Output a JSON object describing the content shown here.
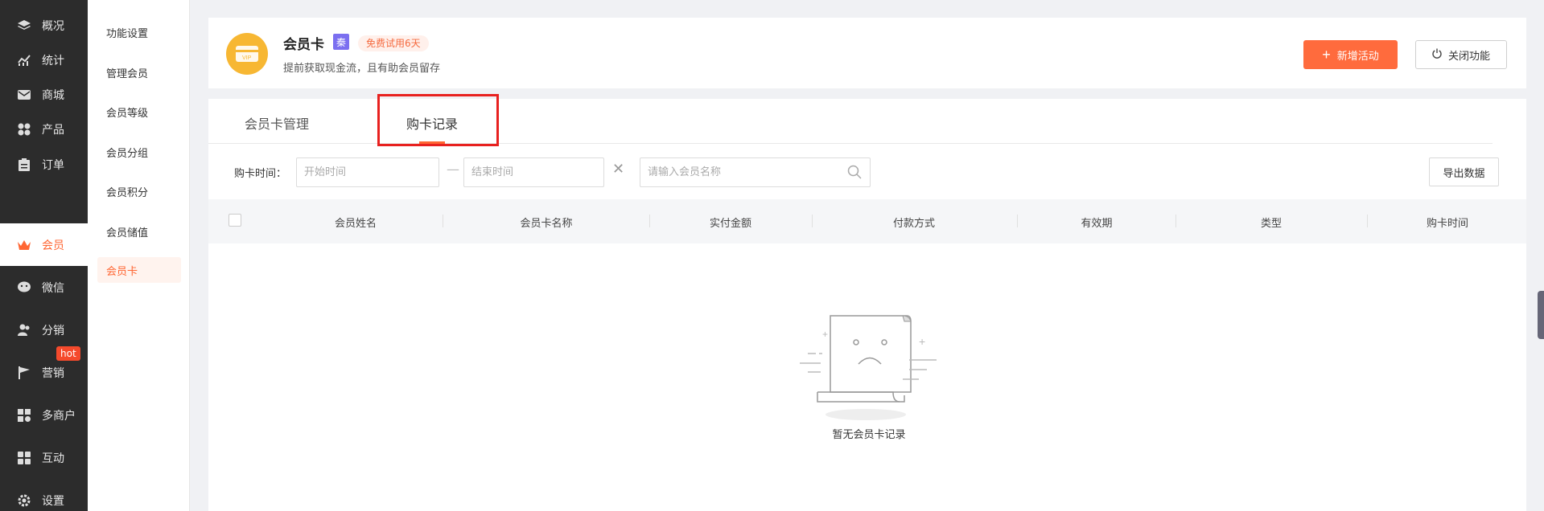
{
  "nav": {
    "items": [
      {
        "label": "概况",
        "icon": "layers-icon"
      },
      {
        "label": "统计",
        "icon": "chart-icon"
      },
      {
        "label": "商城",
        "icon": "mail-icon"
      },
      {
        "label": "产品",
        "icon": "grid-icon"
      },
      {
        "label": "订单",
        "icon": "clipboard-icon"
      },
      {
        "label": "会员",
        "icon": "crown-icon"
      },
      {
        "label": "微信",
        "icon": "wechat-icon"
      },
      {
        "label": "分销",
        "icon": "users-icon"
      },
      {
        "label": "营销",
        "icon": "flag-icon"
      },
      {
        "label": "多商户",
        "icon": "store-icon"
      },
      {
        "label": "互动",
        "icon": "apps-icon"
      },
      {
        "label": "设置",
        "icon": "gear-icon"
      }
    ],
    "active": "会员",
    "hot_badge": "hot"
  },
  "subnav": {
    "items": [
      "功能设置",
      "管理会员",
      "会员等级",
      "会员分组",
      "会员积分",
      "会员储值",
      "会员卡"
    ],
    "active": "会员卡"
  },
  "header": {
    "title": "会员卡",
    "badge": "秦",
    "trial": "免费试用6天",
    "subtitle": "提前获取现金流，且有助会员留存",
    "new_activity": "新增活动",
    "close_feature": "关闭功能",
    "logo_text": "VIP"
  },
  "tabs": [
    {
      "label": "会员卡管理"
    },
    {
      "label": "购卡记录"
    }
  ],
  "active_tab": "购卡记录",
  "filters": {
    "label": "购卡时间：",
    "start_placeholder": "开始时间",
    "end_placeholder": "结束时间",
    "search_placeholder": "请输入会员名称",
    "export": "导出数据"
  },
  "table": {
    "columns": [
      "会员姓名",
      "会员卡名称",
      "实付金额",
      "付款方式",
      "有效期",
      "类型",
      "购卡时间"
    ],
    "rows": []
  },
  "empty_text": "暂无会员卡记录",
  "colors": {
    "accent": "#ff6633",
    "nav_bg": "#2c2c2c",
    "highlight": "#e8211f"
  }
}
